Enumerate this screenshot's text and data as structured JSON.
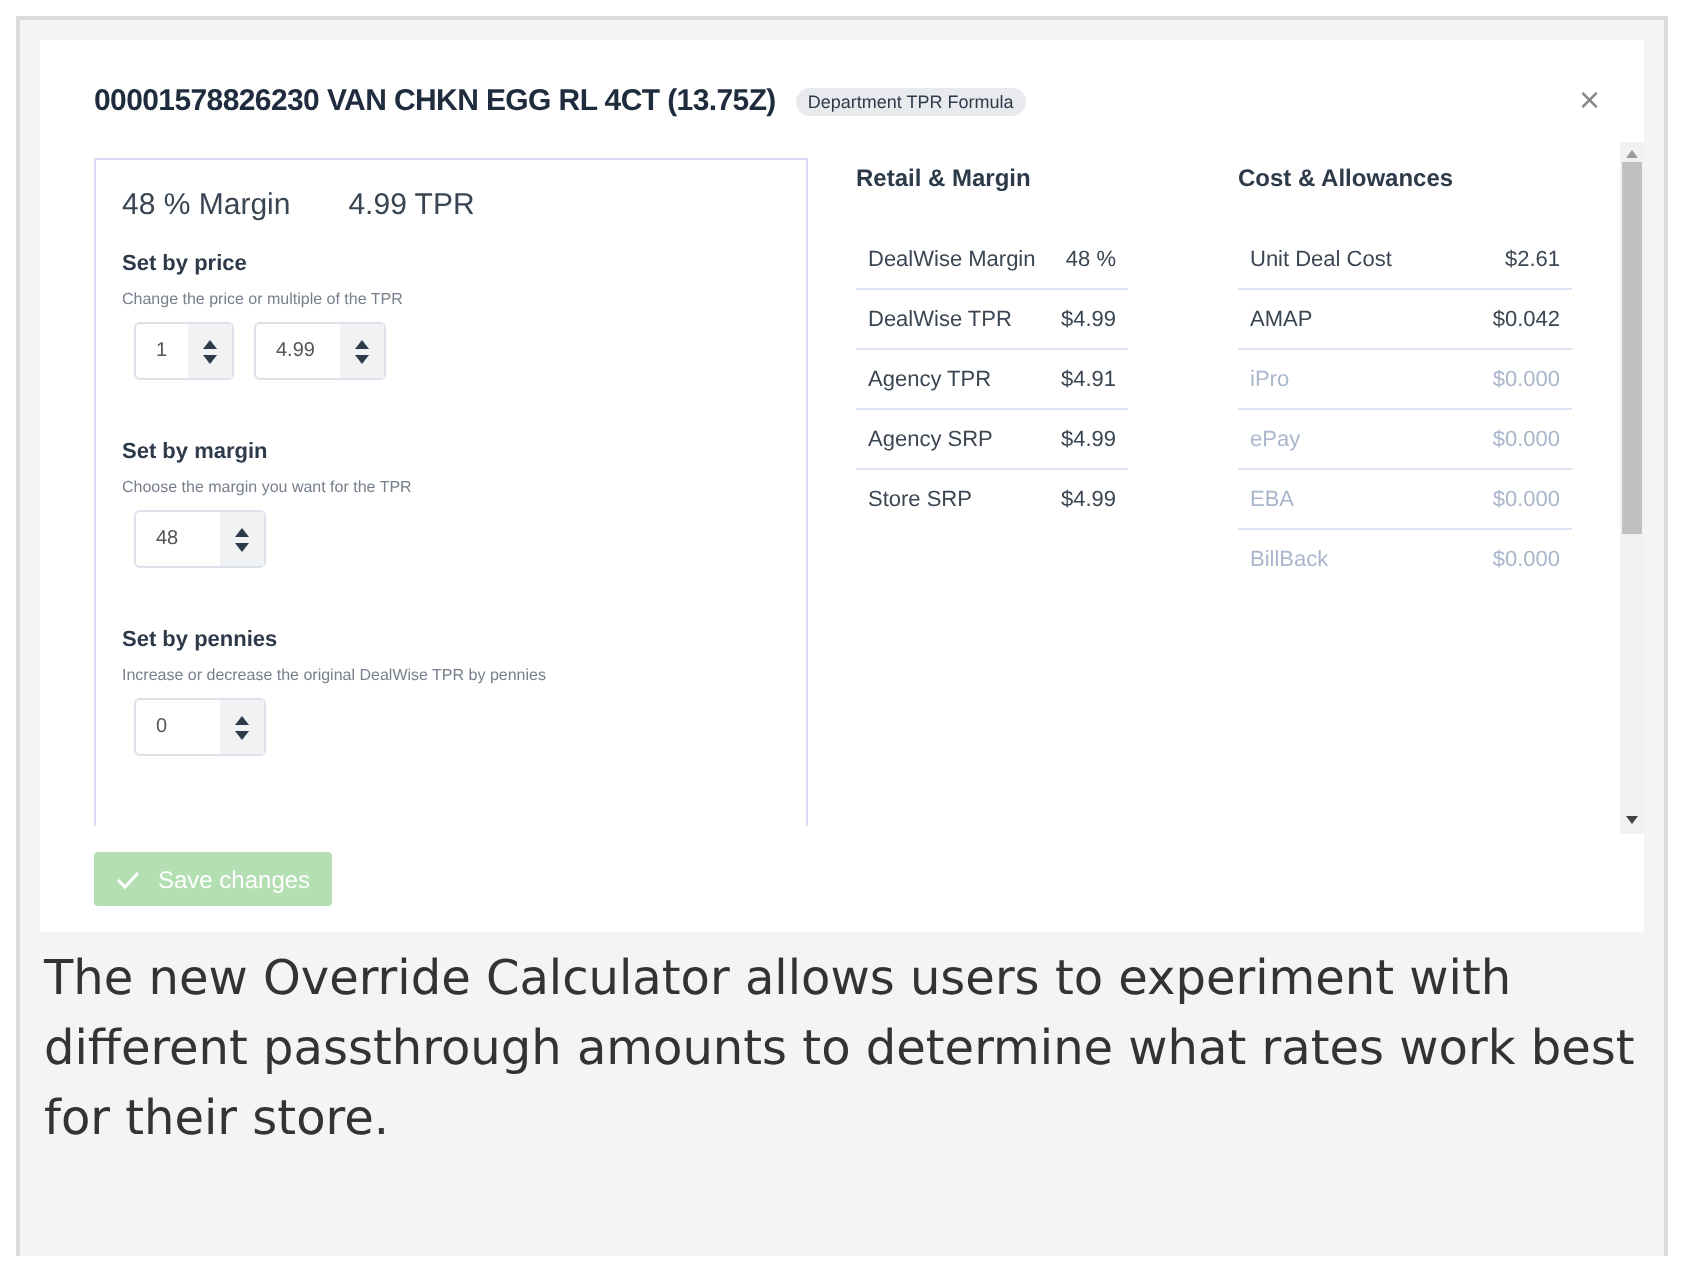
{
  "modal": {
    "title": "00001578826230 VAN CHKN EGG RL 4CT (13.75Z)",
    "badge": "Department TPR Formula",
    "close": "×"
  },
  "calculator": {
    "margin_summary": "48 % Margin",
    "tpr_summary": "4.99 TPR",
    "sections": [
      {
        "heading": "Set by price",
        "hint": "Change the price or multiple of the TPR",
        "fields": [
          {
            "value": "1",
            "wide": false
          },
          {
            "value": "4.99",
            "wide": true
          }
        ]
      },
      {
        "heading": "Set by margin",
        "hint": "Choose the margin you want for the TPR",
        "fields": [
          {
            "value": "48",
            "wide": true
          }
        ]
      },
      {
        "heading": "Set by pennies",
        "hint": "Increase or decrease the original DealWise TPR by pennies",
        "fields": [
          {
            "value": "0",
            "wide": true
          }
        ]
      }
    ]
  },
  "tables": [
    {
      "title": "Retail & Margin",
      "rows": [
        {
          "label": "DealWise Margin",
          "value": "48 %",
          "muted": false
        },
        {
          "label": "DealWise TPR",
          "value": "$4.99",
          "muted": false
        },
        {
          "label": "Agency TPR",
          "value": "$4.91",
          "muted": false
        },
        {
          "label": "Agency SRP",
          "value": "$4.99",
          "muted": false
        },
        {
          "label": "Store SRP",
          "value": "$4.99",
          "muted": false
        }
      ]
    },
    {
      "title": "Cost & Allowances",
      "rows": [
        {
          "label": "Unit Deal Cost",
          "value": "$2.61",
          "muted": false
        },
        {
          "label": "AMAP",
          "value": "$0.042",
          "muted": false
        },
        {
          "label": "iPro",
          "value": "$0.000",
          "muted": true
        },
        {
          "label": "ePay",
          "value": "$0.000",
          "muted": true
        },
        {
          "label": "EBA",
          "value": "$0.000",
          "muted": true
        },
        {
          "label": "BillBack",
          "value": "$0.000",
          "muted": true
        }
      ]
    }
  ],
  "save_button": {
    "label": "Save changes",
    "disabled": true
  },
  "caption": "The new Override Calculator allows users to experiment with different passthrough amounts to determine what rates work best for their store."
}
